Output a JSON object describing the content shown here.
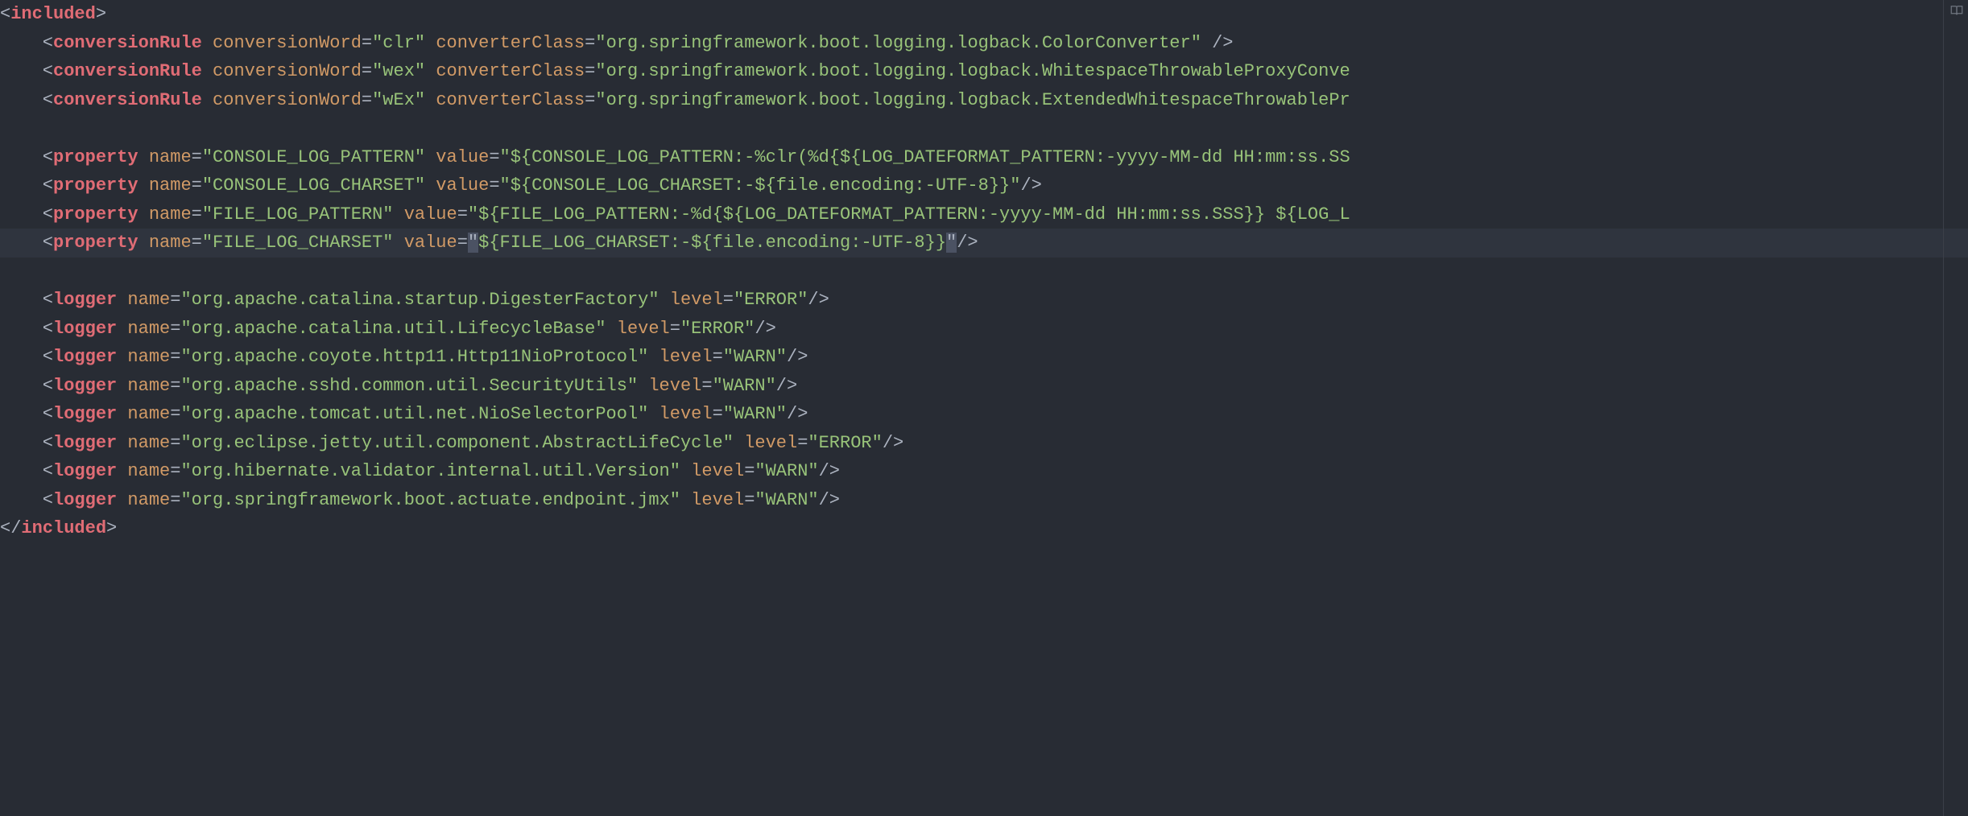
{
  "root_open": "included",
  "root_close": "included",
  "conversionRules": [
    {
      "tag": "conversionRule",
      "attrs": [
        {
          "n": "conversionWord",
          "v": "clr"
        },
        {
          "n": "converterClass",
          "v": "org.springframework.boot.logging.logback.ColorConverter"
        }
      ],
      "spaceBeforeClose": true
    },
    {
      "tag": "conversionRule",
      "attrs": [
        {
          "n": "conversionWord",
          "v": "wex"
        },
        {
          "n": "converterClass",
          "v": "org.springframework.boot.logging.logback.WhitespaceThrowableProxyConve"
        }
      ],
      "spaceBeforeClose": false,
      "truncated": true
    },
    {
      "tag": "conversionRule",
      "attrs": [
        {
          "n": "conversionWord",
          "v": "wEx"
        },
        {
          "n": "converterClass",
          "v": "org.springframework.boot.logging.logback.ExtendedWhitespaceThrowablePr"
        }
      ],
      "spaceBeforeClose": false,
      "truncated": true
    }
  ],
  "properties": [
    {
      "tag": "property",
      "attrs": [
        {
          "n": "name",
          "v": "CONSOLE_LOG_PATTERN"
        },
        {
          "n": "value",
          "v": "${CONSOLE_LOG_PATTERN:-%clr(%d{${LOG_DATEFORMAT_PATTERN:-yyyy-MM-dd HH:mm:ss.SS"
        }
      ],
      "truncated": true
    },
    {
      "tag": "property",
      "attrs": [
        {
          "n": "name",
          "v": "CONSOLE_LOG_CHARSET"
        },
        {
          "n": "value",
          "v": "${CONSOLE_LOG_CHARSET:-${file.encoding:-UTF-8}}"
        }
      ],
      "truncated": false
    },
    {
      "tag": "property",
      "attrs": [
        {
          "n": "name",
          "v": "FILE_LOG_PATTERN"
        },
        {
          "n": "value",
          "v": "${FILE_LOG_PATTERN:-%d{${LOG_DATEFORMAT_PATTERN:-yyyy-MM-dd HH:mm:ss.SSS}} ${LOG_L"
        }
      ],
      "truncated": true
    },
    {
      "tag": "property",
      "attrs": [
        {
          "n": "name",
          "v": "FILE_LOG_CHARSET"
        },
        {
          "n": "value",
          "v": "${FILE_LOG_CHARSET:-${file.encoding:-UTF-8}}"
        }
      ],
      "truncated": false,
      "highlighted": true
    }
  ],
  "loggers": [
    {
      "tag": "logger",
      "attrs": [
        {
          "n": "name",
          "v": "org.apache.catalina.startup.DigesterFactory"
        },
        {
          "n": "level",
          "v": "ERROR"
        }
      ]
    },
    {
      "tag": "logger",
      "attrs": [
        {
          "n": "name",
          "v": "org.apache.catalina.util.LifecycleBase"
        },
        {
          "n": "level",
          "v": "ERROR"
        }
      ]
    },
    {
      "tag": "logger",
      "attrs": [
        {
          "n": "name",
          "v": "org.apache.coyote.http11.Http11NioProtocol"
        },
        {
          "n": "level",
          "v": "WARN"
        }
      ]
    },
    {
      "tag": "logger",
      "attrs": [
        {
          "n": "name",
          "v": "org.apache.sshd.common.util.SecurityUtils"
        },
        {
          "n": "level",
          "v": "WARN"
        }
      ]
    },
    {
      "tag": "logger",
      "attrs": [
        {
          "n": "name",
          "v": "org.apache.tomcat.util.net.NioSelectorPool"
        },
        {
          "n": "level",
          "v": "WARN"
        }
      ]
    },
    {
      "tag": "logger",
      "attrs": [
        {
          "n": "name",
          "v": "org.eclipse.jetty.util.component.AbstractLifeCycle"
        },
        {
          "n": "level",
          "v": "ERROR"
        }
      ]
    },
    {
      "tag": "logger",
      "attrs": [
        {
          "n": "name",
          "v": "org.hibernate.validator.internal.util.Version"
        },
        {
          "n": "level",
          "v": "WARN"
        }
      ]
    },
    {
      "tag": "logger",
      "attrs": [
        {
          "n": "name",
          "v": "org.springframework.boot.actuate.endpoint.jmx"
        },
        {
          "n": "level",
          "v": "WARN"
        }
      ]
    }
  ],
  "indent": "    "
}
